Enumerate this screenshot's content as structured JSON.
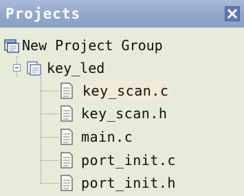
{
  "window": {
    "title": "Projects",
    "close_glyph": "×"
  },
  "tree": {
    "group_label": "New Project Group",
    "project_label": "key_led",
    "files": [
      {
        "label": "key_scan.c",
        "selected": true
      },
      {
        "label": "key_scan.h",
        "selected": false
      },
      {
        "label": "main.c",
        "selected": false
      },
      {
        "label": "port_init.c",
        "selected": false
      },
      {
        "label": "port_init.h",
        "selected": false
      }
    ]
  },
  "colors": {
    "titlebar": "#93a7cc",
    "panel": "#e7ebd9",
    "selection": "#f2ead9"
  },
  "icons": {
    "group": "project-group-icon",
    "project": "project-folder-icon",
    "file": "document-icon",
    "close": "close-icon",
    "collapse": "collapse-minus-icon"
  }
}
